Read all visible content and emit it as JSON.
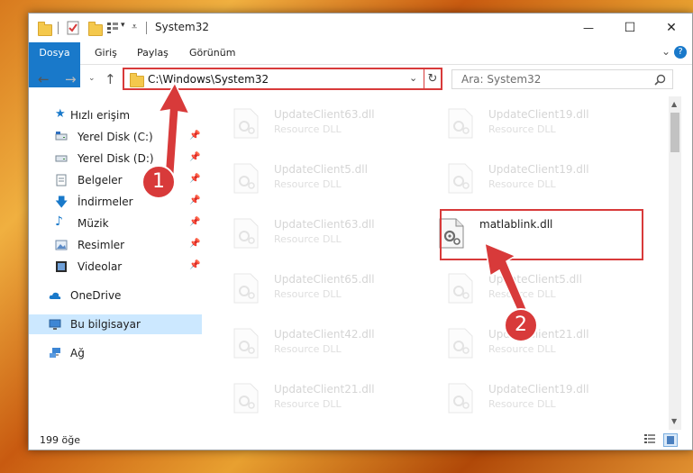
{
  "window": {
    "title": "System32",
    "minimize": "—",
    "maximize": "☐",
    "close": "✕"
  },
  "ribbon": {
    "tabs": [
      "Dosya",
      "Giriş",
      "Paylaş",
      "Görünüm"
    ],
    "expand": "⌄",
    "help": "?"
  },
  "address": {
    "path": "C:\\Windows\\System32",
    "search_placeholder": "Ara: System32"
  },
  "nav_pane": {
    "items": [
      {
        "label": "Hızlı erişim",
        "icon": "star-icon"
      },
      {
        "label": "Yerel Disk (C:)",
        "icon": "drive-icon",
        "pinned": true
      },
      {
        "label": "Yerel Disk (D:)",
        "icon": "drive-icon",
        "pinned": true
      },
      {
        "label": "Belgeler",
        "icon": "documents-icon",
        "pinned": true
      },
      {
        "label": "İndirmeler",
        "icon": "download-icon",
        "pinned": true
      },
      {
        "label": "Müzik",
        "icon": "music-icon",
        "pinned": true
      },
      {
        "label": "Resimler",
        "icon": "pictures-icon",
        "pinned": true
      },
      {
        "label": "Videolar",
        "icon": "videos-icon",
        "pinned": true
      },
      {
        "label": "OneDrive",
        "icon": "cloud-icon"
      },
      {
        "label": "Bu bilgisayar",
        "icon": "computer-icon",
        "selected": true
      },
      {
        "label": "Ağ",
        "icon": "network-icon"
      }
    ]
  },
  "files": {
    "left": [
      {
        "name": "UpdateClient63.dll",
        "desc": "Resource DLL"
      },
      {
        "name": "UpdateClient5.dll",
        "desc": "Resource DLL"
      },
      {
        "name": "UpdateClient63.dll",
        "desc": "Resource DLL"
      },
      {
        "name": "UpdateClient65.dll",
        "desc": "Resource DLL"
      },
      {
        "name": "UpdateClient42.dll",
        "desc": "Resource DLL"
      },
      {
        "name": "UpdateClient21.dll",
        "desc": "Resource DLL"
      }
    ],
    "right": [
      {
        "name": "UpdateClient19.dll",
        "desc": "Resource DLL"
      },
      {
        "name": "UpdateClient19.dll",
        "desc": "Resource DLL"
      },
      {
        "name": "matlablink.dll",
        "desc": "",
        "highlighted": true
      },
      {
        "name": "UpdateClient5.dll",
        "desc": "Resource DLL"
      },
      {
        "name": "UpdateClient21.dll",
        "desc": "Resource DLL"
      },
      {
        "name": "UpdateClient19.dll",
        "desc": "Resource DLL"
      }
    ]
  },
  "status": {
    "count": "199 öğe"
  },
  "callouts": {
    "one": "1",
    "two": "2"
  },
  "colors": {
    "accent": "#1979ca",
    "highlight": "#d83a3a",
    "selection": "#cce8ff"
  }
}
